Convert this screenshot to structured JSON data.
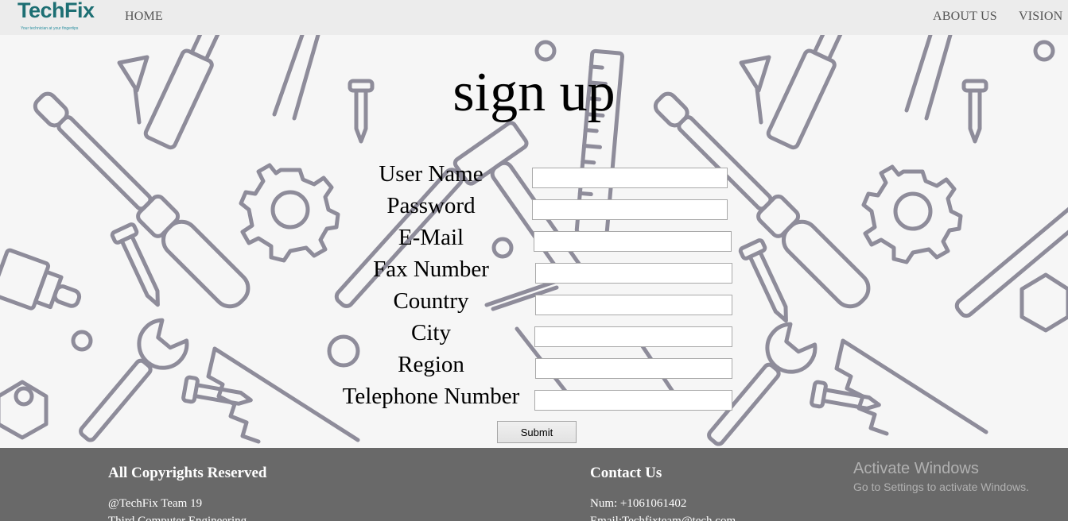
{
  "nav": {
    "logo_text": "TechFix",
    "logo_tagline": "Your technician at your fingertips",
    "links": [
      "HOME",
      "ABOUT US",
      "VISION"
    ]
  },
  "page": {
    "title": "sign up"
  },
  "form": {
    "fields": [
      {
        "label": "User Name",
        "value": ""
      },
      {
        "label": "Password",
        "value": ""
      },
      {
        "label": "E-Mail",
        "value": ""
      },
      {
        "label": "Fax Number",
        "value": ""
      },
      {
        "label": "Country",
        "value": ""
      },
      {
        "label": "City",
        "value": ""
      },
      {
        "label": "Region",
        "value": ""
      },
      {
        "label": "Telephone Number",
        "value": ""
      }
    ],
    "submit_label": "Submit"
  },
  "footer": {
    "left": {
      "heading": "All Copyrights Reserved",
      "lines": [
        "@TechFix Team 19",
        "Third Computer Engineering"
      ]
    },
    "right": {
      "heading": "Contact Us",
      "lines": [
        "Num: +1061061402",
        "Email:Techfixteam@tech.com"
      ]
    }
  },
  "watermark": {
    "title": "Activate Windows",
    "subtitle": "Go to Settings to activate Windows."
  },
  "colors": {
    "nav_bg": "#ececec",
    "page_bg": "#f6f6f6",
    "tool_stroke": "#8e8c9a",
    "footer_bg": "#696969",
    "logo": "#1d6f73"
  }
}
